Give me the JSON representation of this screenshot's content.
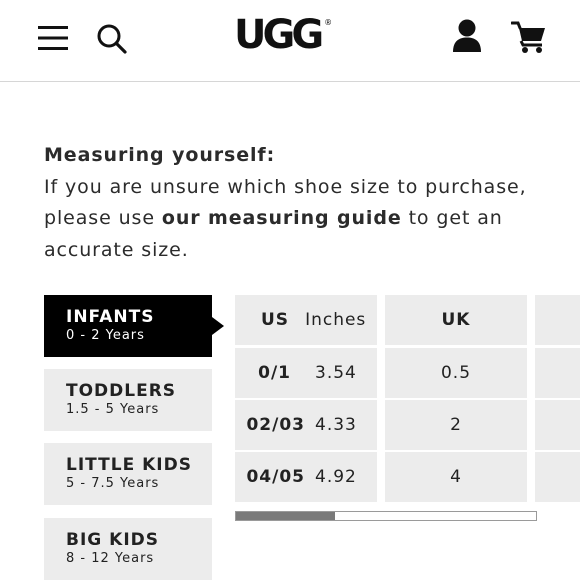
{
  "header": {
    "logo_text": "UGG",
    "logo_mark": "®",
    "icons": [
      "menu-icon",
      "search-icon",
      "account-icon",
      "cart-icon"
    ]
  },
  "intro": {
    "heading": "Measuring yourself:",
    "line1": "If you are unsure which shoe size to purchase,",
    "pre_link": "please use ",
    "link_text": "our measuring guide",
    "post_link": " to get an",
    "line3": "accurate size."
  },
  "tabs": [
    {
      "title": "INFANTS",
      "range": "0 - 2 Years",
      "active": true
    },
    {
      "title": "TODDLERS",
      "range": "1.5 - 5 Years",
      "active": false
    },
    {
      "title": "LITTLE KIDS",
      "range": "5 - 7.5 Years",
      "active": false
    },
    {
      "title": "BIG KIDS",
      "range": "8 - 12 Years",
      "active": false
    }
  ],
  "table": {
    "headers": {
      "us": "US",
      "inches": "Inches",
      "uk": "UK"
    },
    "rows": [
      {
        "us": "0/1",
        "inches": "3.54",
        "uk": "0.5"
      },
      {
        "us": "02/03",
        "inches": "4.33",
        "uk": "2"
      },
      {
        "us": "04/05",
        "inches": "4.92",
        "uk": "4"
      }
    ]
  },
  "scroll_position": 0.33,
  "colors": {
    "active_tab": "#000000",
    "tab_bg": "#ececec",
    "text": "#222222"
  }
}
